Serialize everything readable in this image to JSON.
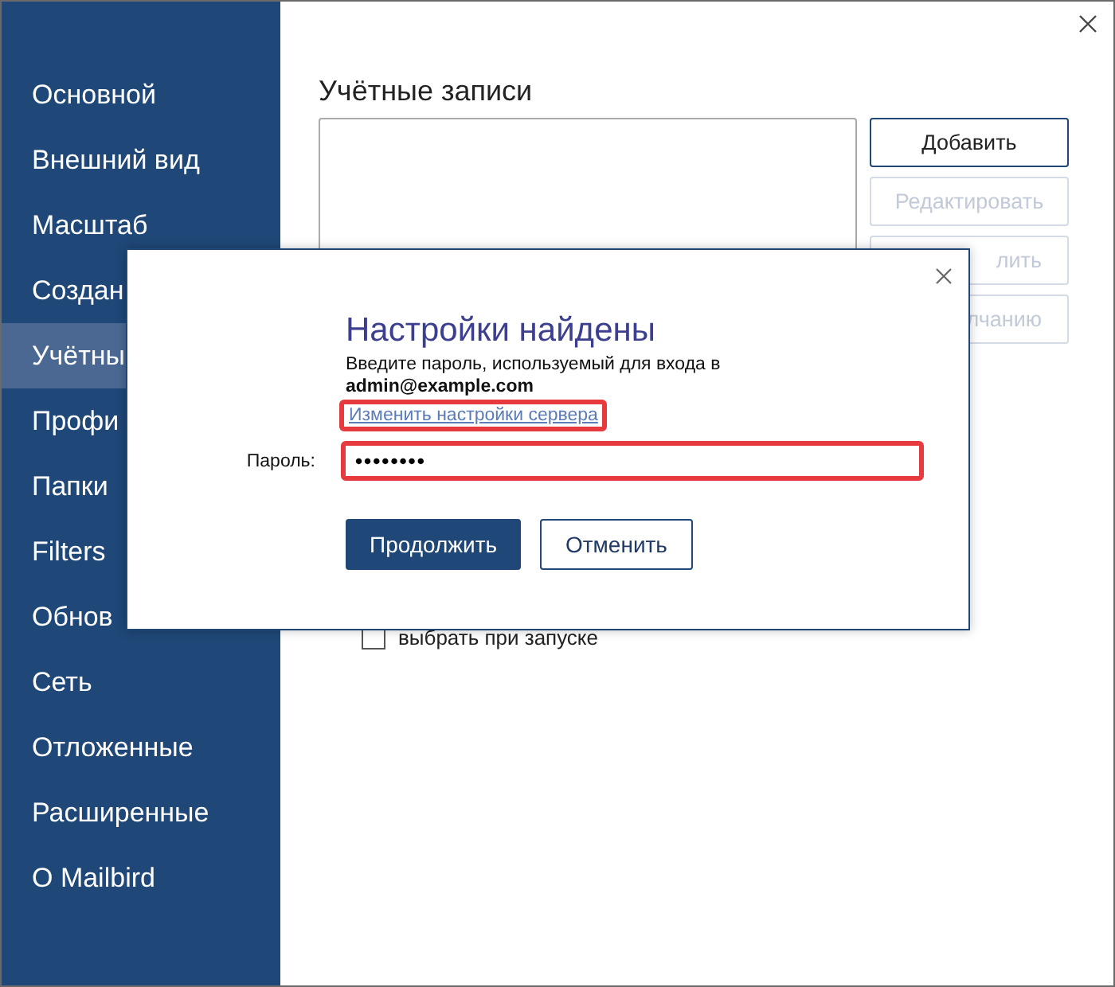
{
  "sidebar": {
    "items": [
      {
        "label": "Основной",
        "selected": false
      },
      {
        "label": "Внешний вид",
        "selected": false
      },
      {
        "label": "Масштаб",
        "selected": false
      },
      {
        "label": "Создан",
        "selected": false
      },
      {
        "label": "Учётны",
        "selected": true
      },
      {
        "label": "Профи",
        "selected": false
      },
      {
        "label": "Папки",
        "selected": false
      },
      {
        "label": "Filters",
        "selected": false
      },
      {
        "label": "Обнов",
        "selected": false
      },
      {
        "label": "Сеть",
        "selected": false
      },
      {
        "label": "Отложенные",
        "selected": false
      },
      {
        "label": "Расширенные",
        "selected": false
      },
      {
        "label": "О Mailbird",
        "selected": false
      }
    ]
  },
  "accounts": {
    "title": "Учётные записи",
    "buttons": [
      {
        "label": "Добавить",
        "disabled": false
      },
      {
        "label": "Редактировать",
        "disabled": true
      },
      {
        "label": "лить",
        "disabled": true
      },
      {
        "label": "лчанию",
        "disabled": true
      }
    ],
    "startup_checkbox": {
      "label": "выбрать при запуске",
      "checked": false
    }
  },
  "dialog": {
    "title": "Настройки найдены",
    "message": "Введите пароль, используемый для входа в",
    "email": "admin@example.com",
    "link": {
      "text": "Изменить настройки сервера",
      "highlighted": true
    },
    "password": {
      "label": "Пароль:",
      "value": "••••••••",
      "highlighted": true
    },
    "buttons": [
      {
        "label": "Продолжить",
        "kind": "primary"
      },
      {
        "label": "Отменить",
        "kind": "secondary"
      }
    ]
  }
}
